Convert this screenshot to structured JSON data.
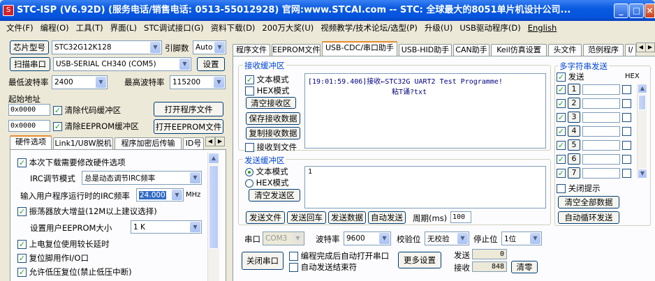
{
  "window": {
    "title": "STC-ISP (V6.92D) (服务电话/销售电话: 0513-55012928) 官网:www.STCAI.com -- STC: 全球最大的8051单片机设计公司..."
  },
  "menu": [
    "文件(F)",
    "编程(O)",
    "工具(T)",
    "界面(L)",
    "STC调试接口(G)",
    "资料下载(D)",
    "200万大奖(U)",
    "视频教学/技术论坛/选型(P)",
    "升级(U)",
    "USB驱动程序(D)",
    "English"
  ],
  "left": {
    "chip_label": "芯片型号",
    "chip_value": "STC32G12K128",
    "pins_label": "引脚数",
    "pins_value": "Auto",
    "scan_label": "扫描串口",
    "port_value": "USB-SERIAL CH340 (COM5)",
    "settings_label": "设置",
    "min_baud_label": "最低波特率",
    "min_baud_value": "2400",
    "max_baud_label": "最高波特率",
    "max_baud_value": "115200",
    "start_addr_label": "起始地址",
    "addr1": "0x0000",
    "clear_code_label": "清除代码缓冲区",
    "open_prog_label": "打开程序文件",
    "addr2": "0x0000",
    "clear_eeprom_label": "清除EEPROM缓冲区",
    "open_eeprom_label": "打开EEPROM文件",
    "tabs": [
      "硬件选项",
      "Link1/U8W脱机",
      "程序加密后传输",
      "ID号"
    ],
    "hw": {
      "modify_label": "本次下载需要修改硬件选项",
      "irc_mode_label": "IRC调节模式",
      "irc_mode_value": "总是动态调节IRC频率",
      "irc_freq_label": "输入用户程序运行时的IRC频率",
      "irc_freq_value": "24.000",
      "irc_freq_unit": "MHz",
      "osc_label": "振荡器放大增益(12M以上建议选择)",
      "eeprom_label": "设置用户EEPROM大小",
      "eeprom_value": "1 K",
      "power_delay_label": "上电复位使用较长延时",
      "reset_io_label": "复位脚用作I/O口",
      "lvr_label": "允许低压复位(禁止低压中断)"
    }
  },
  "right": {
    "tabs": [
      "程序文件",
      "EEPROM文件",
      "USB-CDC/串口助手",
      "USB-HID助手",
      "CAN助手",
      "Keil仿真设置",
      "头文件",
      "范例程序",
      "I/"
    ],
    "recv": {
      "title": "接收缓冲区",
      "text_mode": "文本模式",
      "hex_mode": "HEX模式",
      "clear": "清空接收区",
      "save": "保存接收数据",
      "copy": "复制接收数据",
      "to_file": "接收到文件",
      "line1": "[19:01:59.406]接收←STC32G UART2 Test Programme!",
      "line2": "粘T诵?txt"
    },
    "send": {
      "title": "发送缓冲区",
      "text_mode": "文本模式",
      "hex_mode": "HEX模式",
      "clear": "清空发送区",
      "content": "1",
      "send_file": "发送文件",
      "send_cr": "发送回车",
      "send_data": "发送数据",
      "auto_send": "自动发送",
      "period_label": "周期(ms)",
      "period_value": "100"
    },
    "multi": {
      "title": "多字符串发送",
      "send_label": "发送",
      "hex_label": "HEX",
      "rows": [
        "1",
        "2",
        "3",
        "4",
        "5",
        "6",
        "7"
      ],
      "close_hint": "关闭提示",
      "clear_all": "清空全部数据",
      "auto_loop": "自动循环发送"
    },
    "port": {
      "port_label": "串口",
      "port_value": "COM3",
      "baud_label": "波特率",
      "baud_value": "9600",
      "parity_label": "校验位",
      "parity_value": "无校验",
      "stop_label": "停止位",
      "stop_value": "1位",
      "close_port": "关闭串口",
      "auto_open": "编程完成后自动打开串口",
      "auto_end": "自动发送结束符",
      "more": "更多设置",
      "sent_label": "发送",
      "sent_value": "0",
      "recv_label": "接收",
      "recv_value": "848",
      "clear_count": "清零"
    }
  }
}
